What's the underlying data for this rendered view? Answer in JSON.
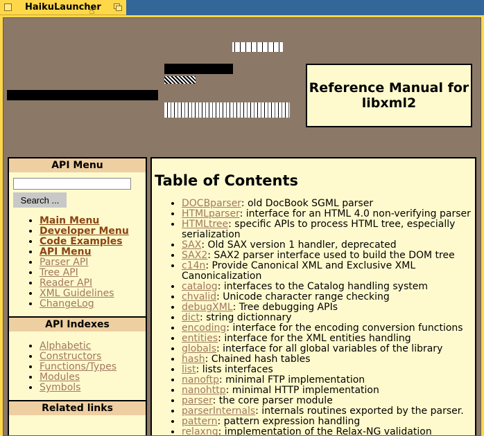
{
  "window": {
    "title": "HaikuLauncher"
  },
  "header": {
    "manual_title": "Reference Manual for libxml2"
  },
  "sidebar": {
    "api_menu_heading": "API Menu",
    "search_placeholder": "",
    "search_button": "Search ...",
    "menu_items": [
      {
        "label": "Main Menu",
        "style": "bold"
      },
      {
        "label": "Developer Menu",
        "style": "bold"
      },
      {
        "label": "Code Examples",
        "style": "bold"
      },
      {
        "label": "API Menu",
        "style": "bold"
      },
      {
        "label": "Parser API",
        "style": "light"
      },
      {
        "label": "Tree API",
        "style": "light"
      },
      {
        "label": "Reader API",
        "style": "light"
      },
      {
        "label": "XML Guidelines",
        "style": "light"
      },
      {
        "label": "ChangeLog",
        "style": "light"
      }
    ],
    "api_indexes_heading": "API Indexes",
    "index_items": [
      "Alphabetic",
      "Constructors",
      "Functions/Types",
      "Modules",
      "Symbols"
    ],
    "related_links_heading": "Related links"
  },
  "main": {
    "toc_title": "Table of Contents",
    "entries": [
      {
        "link": "DOCBparser",
        "desc": ": old DocBook SGML parser"
      },
      {
        "link": "HTMLparser",
        "desc": ": interface for an HTML 4.0 non-verifying parser"
      },
      {
        "link": "HTMLtree",
        "desc": ": specific APIs to process HTML tree, especially serialization"
      },
      {
        "link": "SAX",
        "desc": ": Old SAX version 1 handler, deprecated"
      },
      {
        "link": "SAX2",
        "desc": ": SAX2 parser interface used to build the DOM tree"
      },
      {
        "link": "c14n",
        "desc": ": Provide Canonical XML and Exclusive XML Canonicalization"
      },
      {
        "link": "catalog",
        "desc": ": interfaces to the Catalog handling system"
      },
      {
        "link": "chvalid",
        "desc": ": Unicode character range checking"
      },
      {
        "link": "debugXML",
        "desc": ": Tree debugging APIs"
      },
      {
        "link": "dict",
        "desc": ": string dictionnary"
      },
      {
        "link": "encoding",
        "desc": ": interface for the encoding conversion functions"
      },
      {
        "link": "entities",
        "desc": ": interface for the XML entities handling"
      },
      {
        "link": "globals",
        "desc": ": interface for all global variables of the library"
      },
      {
        "link": "hash",
        "desc": ": Chained hash tables"
      },
      {
        "link": "list",
        "desc": ": lists interfaces"
      },
      {
        "link": "nanoftp",
        "desc": ": minimal FTP implementation"
      },
      {
        "link": "nanohttp",
        "desc": ": minimal HTTP implementation"
      },
      {
        "link": "parser",
        "desc": ": the core parser module"
      },
      {
        "link": "parserInternals",
        "desc": ": internals routines exported by the parser."
      },
      {
        "link": "pattern",
        "desc": ": pattern expression handling"
      },
      {
        "link": "relaxng",
        "desc": ": implementation of the Relax-NG validation"
      }
    ]
  }
}
